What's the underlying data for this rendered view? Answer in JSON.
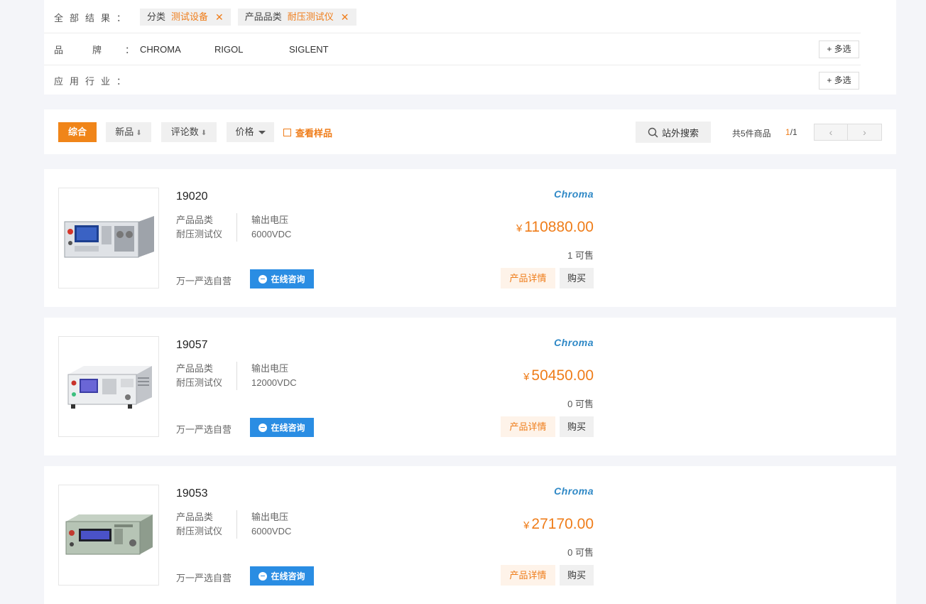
{
  "filters": {
    "all_results_label": "全部结果：",
    "chips": [
      {
        "key": "分类",
        "value": "测试设备",
        "remove": "✕"
      },
      {
        "key": "产品品类",
        "value": "耐压测试仪",
        "remove": "✕"
      }
    ],
    "brand_label_a": "品",
    "brand_label_b": "牌",
    "brand_label_colon": "：",
    "brands": [
      "CHROMA",
      "RIGOL",
      "SIGLENT"
    ],
    "industry_label": "应用行业：",
    "multi_select": "+ 多选"
  },
  "toolbar": {
    "sort_default": "综合",
    "sort_new": "新品",
    "sort_reviews": "评论数",
    "sort_price": "价格",
    "arrow": "⬇",
    "view_samples": "查看样品",
    "external_search": "站外搜索",
    "total": "共5件商品",
    "page_current": "1",
    "page_total": "/1",
    "prev": "‹",
    "next": "›"
  },
  "common": {
    "category_label": "产品品类",
    "voltage_label": "输出电压",
    "seller": "万一严选自营",
    "consult": "在线咨询",
    "detail": "产品详情",
    "buy": "购买",
    "currency": "¥"
  },
  "products": [
    {
      "name": "19020",
      "category": "耐压测试仪",
      "voltage": "6000VDC",
      "brand_logo": "Chroma",
      "price": "110880.00",
      "stock": "1 可售"
    },
    {
      "name": "19057",
      "category": "耐压测试仪",
      "voltage": "12000VDC",
      "brand_logo": "Chroma",
      "price": "50450.00",
      "stock": "0 可售"
    },
    {
      "name": "19053",
      "category": "耐压测试仪",
      "voltage": "6000VDC",
      "brand_logo": "Chroma",
      "price": "27170.00",
      "stock": "0 可售"
    }
  ],
  "colors": {
    "accent_orange": "#ef7d1a",
    "consult_blue": "#2a8de3",
    "brand_blue": "#2e88c6",
    "page_bg": "#f4f5f9"
  }
}
